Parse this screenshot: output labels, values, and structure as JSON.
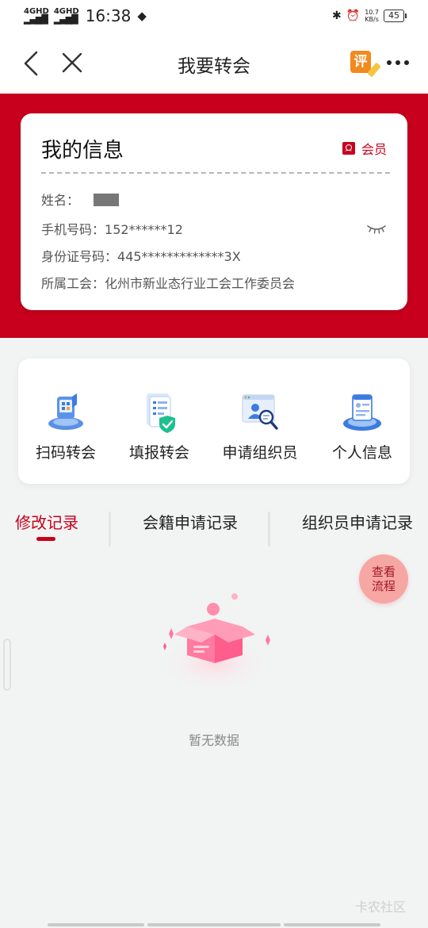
{
  "status_bar": {
    "network_1": "4GHD",
    "network_2": "4GHD",
    "time": "16:38",
    "speed_value": "10.7",
    "speed_unit": "KB/s",
    "battery": "45"
  },
  "nav": {
    "title": "我要转会",
    "eval_label": "评"
  },
  "info_card": {
    "title": "我的信息",
    "member_label": "会员",
    "name_label": "姓名：",
    "phone_label": "手机号码：",
    "phone_value": "152******12",
    "id_label": "身份证号码：",
    "id_value": "445*************3X",
    "union_label": "所属工会：",
    "union_value": "化州市新业态行业工会工作委员会"
  },
  "functions": [
    {
      "label": "扫码转会",
      "icon": "scan-transfer-icon"
    },
    {
      "label": "填报转会",
      "icon": "form-transfer-icon"
    },
    {
      "label": "申请组织员",
      "icon": "apply-organizer-icon"
    },
    {
      "label": "个人信息",
      "icon": "personal-info-icon"
    }
  ],
  "tabs": [
    {
      "label": "修改记录",
      "active": true
    },
    {
      "label": "会籍申请记录",
      "active": false
    },
    {
      "label": "组织员申请记录",
      "active": false
    }
  ],
  "flow_button": {
    "line1": "查看",
    "line2": "流程"
  },
  "empty_state": {
    "text": "暂无数据"
  },
  "watermark": "卡农社区",
  "colors": {
    "brand_red": "#c8001d",
    "background": "#f2f3f3",
    "flow_button": "#f7a7a3"
  }
}
